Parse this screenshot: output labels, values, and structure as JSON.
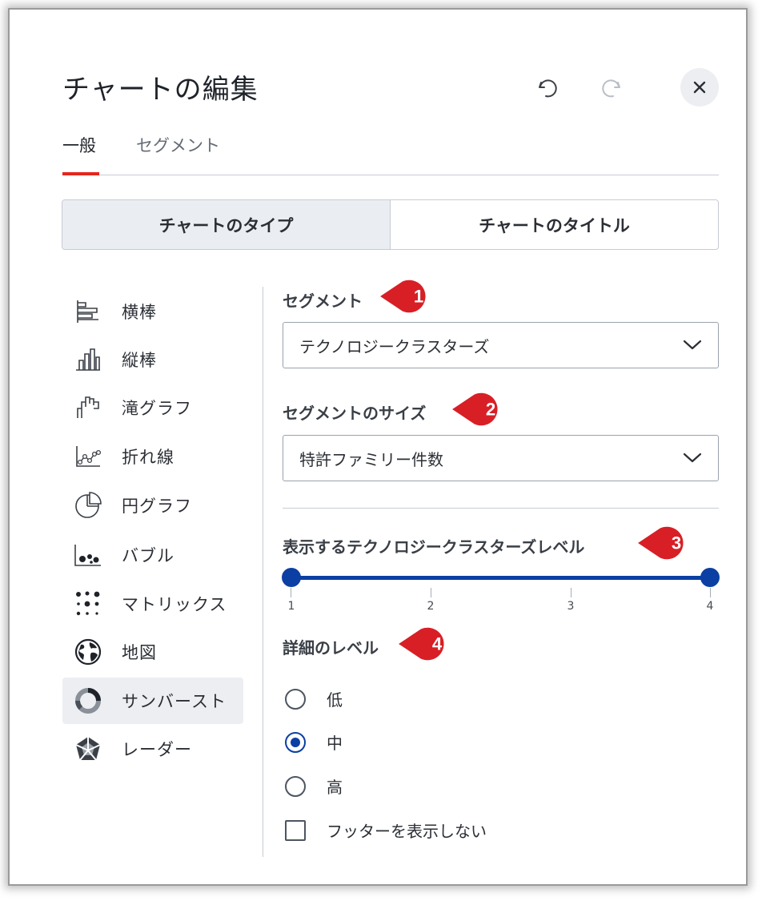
{
  "dialog": {
    "title": "チャートの編集",
    "undo_icon": "undo-icon",
    "redo_icon": "redo-icon",
    "close_icon": "close-icon"
  },
  "tabs": [
    {
      "label": "一般",
      "active": true
    },
    {
      "label": "セグメント",
      "active": false
    }
  ],
  "section_toggle": [
    {
      "label": "チャートのタイプ",
      "active": true
    },
    {
      "label": "チャートのタイトル",
      "active": false
    }
  ],
  "chart_types": [
    {
      "label": "横棒",
      "icon": "horizontal-bar-icon",
      "selected": false
    },
    {
      "label": "縦棒",
      "icon": "vertical-bar-icon",
      "selected": false
    },
    {
      "label": "滝グラフ",
      "icon": "waterfall-icon",
      "selected": false
    },
    {
      "label": "折れ線",
      "icon": "line-chart-icon",
      "selected": false
    },
    {
      "label": "円グラフ",
      "icon": "pie-chart-icon",
      "selected": false
    },
    {
      "label": "バブル",
      "icon": "bubble-chart-icon",
      "selected": false
    },
    {
      "label": "マトリックス",
      "icon": "matrix-icon",
      "selected": false
    },
    {
      "label": "地図",
      "icon": "globe-icon",
      "selected": false
    },
    {
      "label": "サンバースト",
      "icon": "sunburst-icon",
      "selected": true
    },
    {
      "label": "レーダー",
      "icon": "radar-icon",
      "selected": false
    }
  ],
  "settings": {
    "segment_label": "セグメント",
    "segment_value": "テクノロジークラスターズ",
    "size_label": "セグメントのサイズ",
    "size_value": "特許ファミリー件数",
    "level_label": "表示するテクノロジークラスターズレベル",
    "level_range": {
      "min": 1,
      "max": 4,
      "selected_from": 1,
      "selected_to": 4
    },
    "tick_labels": [
      "1",
      "2",
      "3",
      "4"
    ],
    "detail_label": "詳細のレベル",
    "detail_options": [
      {
        "label": "低",
        "checked": false
      },
      {
        "label": "中",
        "checked": true
      },
      {
        "label": "高",
        "checked": false
      }
    ],
    "hide_footer_label": "フッターを表示しない",
    "hide_footer_checked": false
  },
  "callouts": [
    "1",
    "2",
    "3",
    "4"
  ],
  "colors": {
    "accent": "#0b3fa3",
    "tab_underline": "#e5261d",
    "callout": "#d81f26"
  }
}
